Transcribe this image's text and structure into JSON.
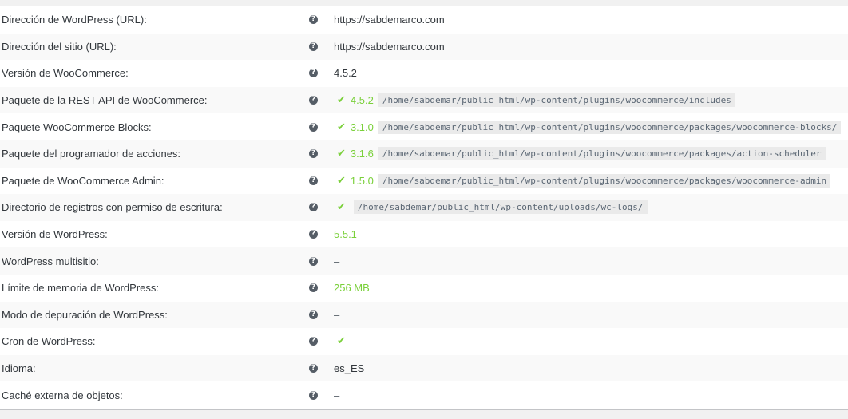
{
  "rows": [
    {
      "label": "Dirección de WordPress (URL):",
      "value": "https://sabdemarco.com"
    },
    {
      "label": "Dirección del sitio (URL):",
      "value": "https://sabdemarco.com"
    },
    {
      "label": "Versión de WooCommerce:",
      "value": "4.5.2"
    },
    {
      "label": "Paquete de la REST API de WooCommerce:",
      "version": "4.5.2",
      "path": "/home/sabdemar/public_html/wp-content/plugins/woocommerce/includes"
    },
    {
      "label": "Paquete WooCommerce Blocks:",
      "version": "3.1.0",
      "path": "/home/sabdemar/public_html/wp-content/plugins/woocommerce/packages/woocommerce-blocks/"
    },
    {
      "label": "Paquete del programador de acciones:",
      "version": "3.1.6",
      "path": "/home/sabdemar/public_html/wp-content/plugins/woocommerce/packages/action-scheduler"
    },
    {
      "label": "Paquete de WooCommerce Admin:",
      "version": "1.5.0",
      "path": "/home/sabdemar/public_html/wp-content/plugins/woocommerce/packages/woocommerce-admin"
    },
    {
      "label": "Directorio de registros con permiso de escritura:",
      "path": "/home/sabdemar/public_html/wp-content/uploads/wc-logs/"
    },
    {
      "label": "Versión de WordPress:",
      "value": "5.5.1"
    },
    {
      "label": "WordPress multisitio:",
      "value": "–"
    },
    {
      "label": "Límite de memoria de WordPress:",
      "value": "256 MB"
    },
    {
      "label": "Modo de depuración de WordPress:",
      "value": "–"
    },
    {
      "label": "Cron de WordPress:"
    },
    {
      "label": "Idioma:",
      "value": "es_ES"
    },
    {
      "label": "Caché externa de objetos:",
      "value": "–"
    }
  ],
  "icons": {
    "help": "help-circle-icon",
    "check": "checkmark-icon"
  },
  "colors": {
    "ok": "#7ad03a",
    "help_bg": "#555d66"
  }
}
